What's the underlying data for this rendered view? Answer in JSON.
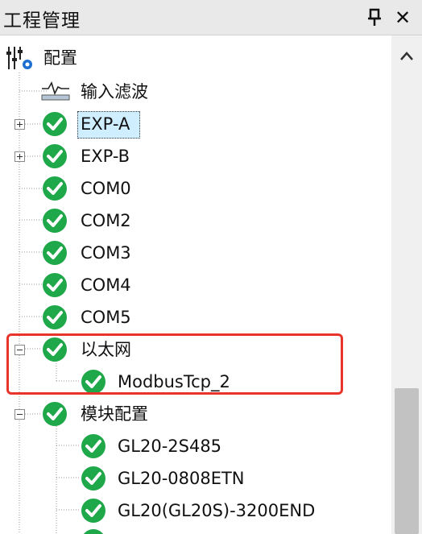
{
  "panel": {
    "title": "工程管理",
    "pin_icon": "pin-icon",
    "close_label": "✕"
  },
  "tree": {
    "root": {
      "label": "配置",
      "icon": "config-settings-icon"
    },
    "input_filter": {
      "label": "输入滤波",
      "icon": "waveform-icon"
    },
    "items": [
      {
        "label": "EXP-A",
        "status": "ok",
        "expander": "plus",
        "selected": true
      },
      {
        "label": "EXP-B",
        "status": "ok",
        "expander": "plus"
      },
      {
        "label": "COM0",
        "status": "ok"
      },
      {
        "label": "COM2",
        "status": "ok"
      },
      {
        "label": "COM3",
        "status": "ok"
      },
      {
        "label": "COM4",
        "status": "ok"
      },
      {
        "label": "COM5",
        "status": "ok"
      },
      {
        "label": "以太网",
        "status": "ok",
        "expander": "minus"
      },
      {
        "label": "ModbusTcp_2",
        "status": "ok"
      },
      {
        "label": "模块配置",
        "status": "ok",
        "expander": "minus"
      },
      {
        "label": "GL20-2S485",
        "status": "ok"
      },
      {
        "label": "GL20-0808ETN",
        "status": "ok"
      },
      {
        "label": "GL20(GL20S)-3200END",
        "status": "ok"
      }
    ]
  },
  "colors": {
    "check_green": "#1fa84a",
    "highlight_red": "#e8352b",
    "selection_bg": "#cfeeff"
  }
}
